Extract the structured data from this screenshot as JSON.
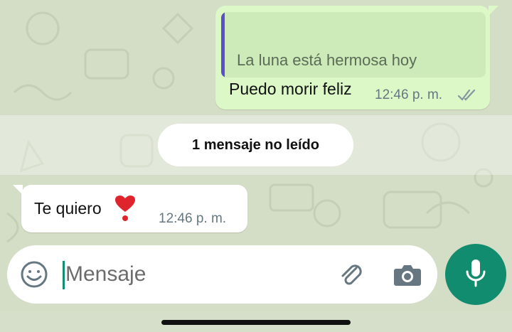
{
  "chat": {
    "outgoing": {
      "quoted_text": "La luna está hermosa hoy",
      "text": "Puedo morir feliz",
      "time": "12:46 p. m.",
      "status_icon": "double-check-icon"
    },
    "unread_divider": "1 mensaje no leído",
    "incoming": {
      "text": "Te quiero",
      "emoji_icon": "heart-exclamation-emoji",
      "time": "12:46 p. m."
    }
  },
  "composer": {
    "placeholder": "Mensaje",
    "emoji_icon": "smiley-icon",
    "attach_icon": "paperclip-icon",
    "camera_icon": "camera-icon",
    "mic_icon": "microphone-icon"
  },
  "colors": {
    "wallpaper": "#d4ddc6",
    "outgoing_bubble": "#dcf8c6",
    "quote_bar": "#5b4fc9",
    "mic_button": "#128c6e"
  }
}
